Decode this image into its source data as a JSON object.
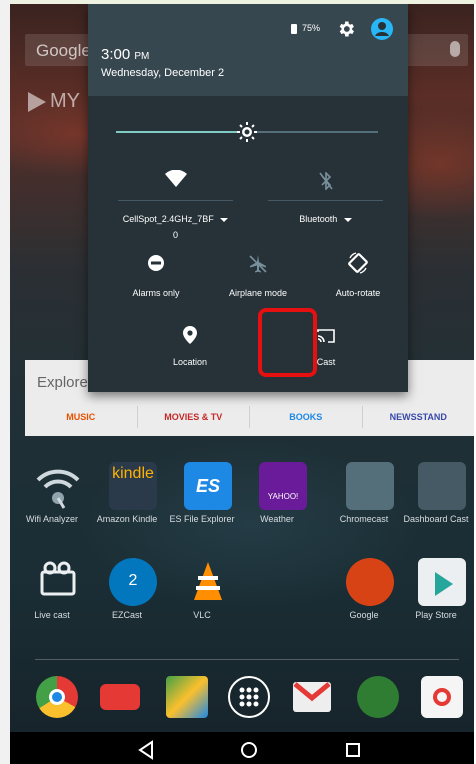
{
  "status": {
    "battery": "75%",
    "time": "3:00",
    "time_suffix": "PM",
    "date": "Wednesday, December 2"
  },
  "background": {
    "search_hint": "Google",
    "my_label": "MY",
    "explore": {
      "title": "Explore",
      "categories": [
        {
          "label": "MUSIC",
          "color": "#e65100"
        },
        {
          "label": "MOVIES & TV",
          "color": "#c62828"
        },
        {
          "label": "BOOKS",
          "color": "#1e88e5"
        },
        {
          "label": "NEWSSTAND",
          "color": "#3949ab"
        }
      ]
    }
  },
  "quick_settings": {
    "brightness_level": 0.5,
    "tiles": {
      "wifi": {
        "label": "CellSpot_2.4GHz_7BF",
        "sub": "0",
        "icon": "wifi-icon"
      },
      "bluetooth": {
        "label": "Bluetooth",
        "icon": "bluetooth-off-icon"
      },
      "alarms": {
        "label": "Alarms only",
        "icon": "do-not-disturb-icon"
      },
      "airplane": {
        "label": "Airplane mode",
        "icon": "airplane-icon"
      },
      "autorotate": {
        "label": "Auto-rotate",
        "icon": "auto-rotate-icon"
      },
      "location": {
        "label": "Location",
        "icon": "location-pin-icon"
      },
      "cast": {
        "label": "Cast",
        "icon": "cast-icon"
      }
    }
  },
  "apps": [
    {
      "name": "Wifi Analyzer",
      "color": "#37474f"
    },
    {
      "name": "Amazon Kindle",
      "color": "#2b3a4a"
    },
    {
      "name": "ES File Explorer",
      "color": "#1e88e5"
    },
    {
      "name": "Weather",
      "color": "#6a1b9a"
    },
    {
      "name": "Chromecast",
      "color": "#546e7a"
    },
    {
      "name": "Dashboard Cast",
      "color": "#455a64"
    },
    {
      "name": "Live cast",
      "color": "#37474f"
    },
    {
      "name": "EZCast",
      "color": "#0277bd"
    },
    {
      "name": "VLC",
      "color": "#ff8f00"
    },
    {
      "name": "Google",
      "color": "#d84315"
    },
    {
      "name": "Play Store",
      "color": "#26a69a"
    }
  ],
  "app_badges": {
    "kindle": "kindle",
    "es": "ES",
    "yahoo": "YAHOO!",
    "ez": "2"
  },
  "dock": [
    {
      "icon": "chrome-icon",
      "color": "#fbc02d"
    },
    {
      "icon": "youtube-icon",
      "color": "#e53935"
    },
    {
      "icon": "maps-icon",
      "color": "#43a047"
    },
    {
      "icon": "app-drawer-icon",
      "color": "#263238"
    },
    {
      "icon": "gmail-icon",
      "color": "#e0e0e0"
    },
    {
      "icon": "hangouts-icon",
      "color": "#2e7d32"
    },
    {
      "icon": "photos-icon",
      "color": "#f5f5f5"
    }
  ]
}
